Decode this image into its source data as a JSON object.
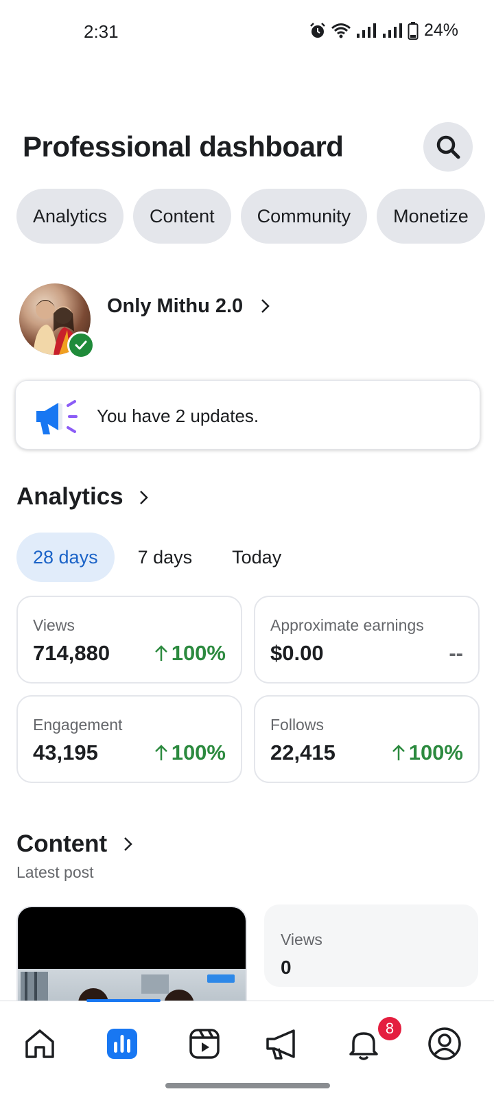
{
  "status_bar": {
    "time": "2:31",
    "battery": "24%"
  },
  "header": {
    "title": "Professional dashboard"
  },
  "chips": [
    {
      "label": "Analytics"
    },
    {
      "label": "Content"
    },
    {
      "label": "Community"
    },
    {
      "label": "Monetize"
    }
  ],
  "profile": {
    "name": "Only Mithu 2.0"
  },
  "updates": {
    "text": "You have 2 updates."
  },
  "analytics": {
    "title": "Analytics",
    "ranges": [
      "28 days",
      "7 days",
      "Today"
    ],
    "selected_range": "28 days",
    "metrics": [
      {
        "label": "Views",
        "value": "714,880",
        "change": "100%"
      },
      {
        "label": "Approximate earnings",
        "value": "$0.00",
        "change": "--"
      },
      {
        "label": "Engagement",
        "value": "43,195",
        "change": "100%"
      },
      {
        "label": "Follows",
        "value": "22,415",
        "change": "100%"
      }
    ]
  },
  "content": {
    "title": "Content",
    "subtitle": "Latest post",
    "latest_views_label": "Views",
    "latest_views_value": "0"
  },
  "bottom_nav": {
    "items": [
      "home-icon",
      "dashboard-icon",
      "reels-icon",
      "ads-megaphone-icon",
      "notifications-bell-icon",
      "profile-icon"
    ],
    "active": "dashboard-icon",
    "notification_count": "8"
  },
  "colors": {
    "accent": "#1877f2",
    "positive": "#2c8a3f",
    "active_tab_bg": "#e1ecfa",
    "badge": "#e41e3f"
  }
}
